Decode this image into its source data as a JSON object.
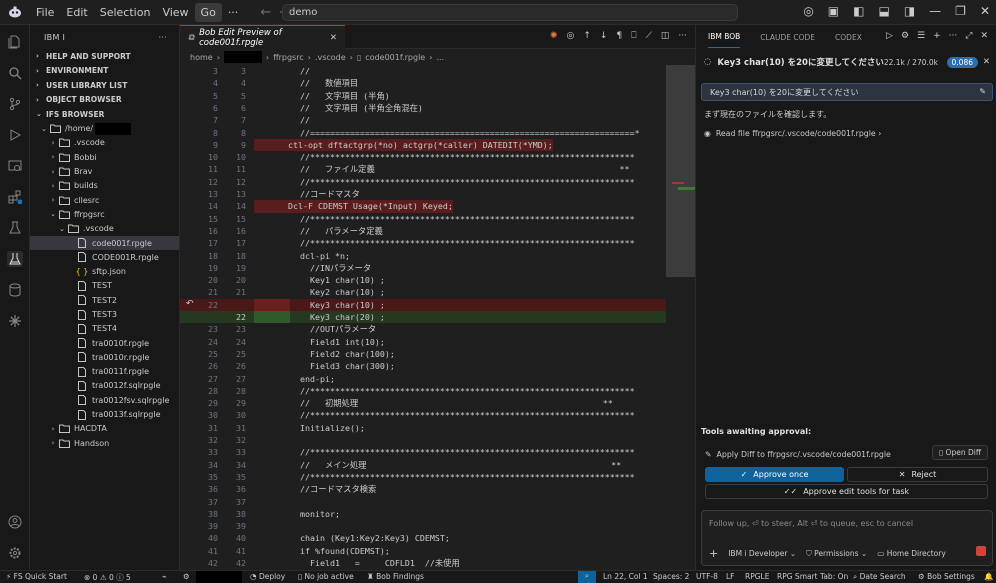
{
  "menu": {
    "items": [
      "File",
      "Edit",
      "Selection",
      "View",
      "Go"
    ],
    "more": "···"
  },
  "search": {
    "value": "demo"
  },
  "activity": {
    "icons": [
      "files-icon",
      "search-icon",
      "source-control-icon",
      "run-debug-icon",
      "remote-explorer-icon",
      "extensions-icon",
      "testing-icon",
      "ibmi-icon",
      "database-icon",
      "bob-icon",
      "account-icon",
      "settings-icon"
    ]
  },
  "sidebar": {
    "title": "IBM I",
    "sections": [
      "HELP AND SUPPORT",
      "ENVIRONMENT",
      "USER LIBRARY LIST",
      "OBJECT BROWSER",
      "IFS BROWSER"
    ],
    "tree": [
      {
        "label": "/home/",
        "indent": 1,
        "twisty": "⌄",
        "icon": "folder-open",
        "redact": true
      },
      {
        "label": ".vscode",
        "indent": 2,
        "twisty": "›",
        "icon": "folder"
      },
      {
        "label": "Bobbi",
        "indent": 2,
        "twisty": "›",
        "icon": "folder"
      },
      {
        "label": "Brav",
        "indent": 2,
        "twisty": "›",
        "icon": "folder"
      },
      {
        "label": "builds",
        "indent": 2,
        "twisty": "›",
        "icon": "folder"
      },
      {
        "label": "cllesrc",
        "indent": 2,
        "twisty": "›",
        "icon": "folder"
      },
      {
        "label": "ffrpgsrc",
        "indent": 2,
        "twisty": "⌄",
        "icon": "folder-open"
      },
      {
        "label": ".vscode",
        "indent": 3,
        "twisty": "⌄",
        "icon": "folder-open"
      },
      {
        "label": "code001f.rpgle",
        "indent": 4,
        "twisty": "",
        "icon": "file",
        "selected": true
      },
      {
        "label": "CODE001R.rpgle",
        "indent": 4,
        "twisty": "",
        "icon": "file"
      },
      {
        "label": "sftp.json",
        "indent": 4,
        "twisty": "",
        "icon": "json"
      },
      {
        "label": "TEST",
        "indent": 4,
        "twisty": "",
        "icon": "file"
      },
      {
        "label": "TEST2",
        "indent": 4,
        "twisty": "",
        "icon": "file"
      },
      {
        "label": "TEST3",
        "indent": 4,
        "twisty": "",
        "icon": "file"
      },
      {
        "label": "TEST4",
        "indent": 4,
        "twisty": "",
        "icon": "file"
      },
      {
        "label": "tra0010f.rpgle",
        "indent": 4,
        "twisty": "",
        "icon": "file"
      },
      {
        "label": "tra0010r.rpgle",
        "indent": 4,
        "twisty": "",
        "icon": "file"
      },
      {
        "label": "tra0011f.rpgle",
        "indent": 4,
        "twisty": "",
        "icon": "file"
      },
      {
        "label": "tra0012f.sqlrpgle",
        "indent": 4,
        "twisty": "",
        "icon": "file"
      },
      {
        "label": "tra0012fsv.sqlrpgle",
        "indent": 4,
        "twisty": "",
        "icon": "file"
      },
      {
        "label": "tra0013f.sqlrpgle",
        "indent": 4,
        "twisty": "",
        "icon": "file"
      },
      {
        "label": "HACDTA",
        "indent": 2,
        "twisty": "›",
        "icon": "folder"
      },
      {
        "label": "Handson",
        "indent": 2,
        "twisty": "›",
        "icon": "folder"
      }
    ]
  },
  "editor": {
    "tab_title": "Bob Edit Preview of code001f.rpgle",
    "breadcrumb": [
      "home",
      "ffrpgsrc",
      ".vscode",
      "code001f.rpgle",
      "..."
    ],
    "lines": [
      {
        "l": "3",
        "r": "3",
        "t": "  //",
        "kind": ""
      },
      {
        "l": "4",
        "r": "4",
        "t": "  //   数値項目",
        "kind": ""
      },
      {
        "l": "5",
        "r": "5",
        "t": "  //   文字項目 (半角)",
        "kind": ""
      },
      {
        "l": "6",
        "r": "6",
        "t": "  //   文字項目 (半角全角混在)",
        "kind": ""
      },
      {
        "l": "7",
        "r": "7",
        "t": "  //",
        "kind": ""
      },
      {
        "l": "8",
        "r": "8",
        "t": "  //=================================================================*",
        "kind": ""
      },
      {
        "l": "9",
        "r": "9",
        "t": "ctl-opt dftactgrp(*no) actgrp(*caller) DATEDIT(*YMD);",
        "kind": "mark"
      },
      {
        "l": "10",
        "r": "10",
        "t": "  //*****************************************************************",
        "kind": ""
      },
      {
        "l": "11",
        "r": "11",
        "t": "  //   ファイル定義                                                 **",
        "kind": ""
      },
      {
        "l": "12",
        "r": "12",
        "t": "  //*****************************************************************",
        "kind": ""
      },
      {
        "l": "13",
        "r": "13",
        "t": "  //コードマスタ",
        "kind": ""
      },
      {
        "l": "14",
        "r": "14",
        "t": "Dcl-F CDEMST Usage(*Input) Keyed;",
        "kind": "mark"
      },
      {
        "l": "15",
        "r": "15",
        "t": "  //*****************************************************************",
        "kind": ""
      },
      {
        "l": "16",
        "r": "16",
        "t": "  //   パラメータ定義",
        "kind": ""
      },
      {
        "l": "17",
        "r": "17",
        "t": "  //*****************************************************************",
        "kind": ""
      },
      {
        "l": "18",
        "r": "18",
        "t": "  dcl-pi *n;",
        "kind": ""
      },
      {
        "l": "19",
        "r": "19",
        "t": "    //INパラメータ",
        "kind": ""
      },
      {
        "l": "20",
        "r": "20",
        "t": "    Key1 char(10) ;",
        "kind": ""
      },
      {
        "l": "21",
        "r": "21",
        "t": "    Key2 char(10) ;",
        "kind": ""
      },
      {
        "l": "22",
        "r": "",
        "t": "    Key3 char(10) ;",
        "kind": "del"
      },
      {
        "l": "",
        "r": "22",
        "t": "    Key3 char(20) ;",
        "kind": "add"
      },
      {
        "l": "23",
        "r": "23",
        "t": "    //OUTパラメータ",
        "kind": ""
      },
      {
        "l": "24",
        "r": "24",
        "t": "    Field1 int(10);",
        "kind": ""
      },
      {
        "l": "25",
        "r": "25",
        "t": "    Field2 char(100);",
        "kind": ""
      },
      {
        "l": "26",
        "r": "26",
        "t": "    Field3 char(300);",
        "kind": ""
      },
      {
        "l": "27",
        "r": "27",
        "t": "  end-pi;",
        "kind": ""
      },
      {
        "l": "28",
        "r": "28",
        "t": "  //*****************************************************************",
        "kind": ""
      },
      {
        "l": "29",
        "r": "29",
        "t": "  //   初期処理                                                 **",
        "kind": ""
      },
      {
        "l": "30",
        "r": "30",
        "t": "  //*****************************************************************",
        "kind": ""
      },
      {
        "l": "31",
        "r": "31",
        "t": "  Initialize();",
        "kind": ""
      },
      {
        "l": "32",
        "r": "32",
        "t": "",
        "kind": ""
      },
      {
        "l": "33",
        "r": "33",
        "t": "  //*****************************************************************",
        "kind": ""
      },
      {
        "l": "34",
        "r": "34",
        "t": "  //   メイン処理                                                 **",
        "kind": ""
      },
      {
        "l": "35",
        "r": "35",
        "t": "  //*****************************************************************",
        "kind": ""
      },
      {
        "l": "36",
        "r": "36",
        "t": "  //コードマスタ検索",
        "kind": ""
      },
      {
        "l": "37",
        "r": "37",
        "t": "",
        "kind": ""
      },
      {
        "l": "38",
        "r": "38",
        "t": "  monitor;",
        "kind": ""
      },
      {
        "l": "39",
        "r": "39",
        "t": "",
        "kind": ""
      },
      {
        "l": "40",
        "r": "40",
        "t": "  chain (Key1:Key2:Key3) CDEMST;",
        "kind": ""
      },
      {
        "l": "41",
        "r": "41",
        "t": "  if %found(CDEMST);",
        "kind": ""
      },
      {
        "l": "42",
        "r": "42",
        "t": "    Field1   =     CDFLD1  //未使用",
        "kind": ""
      }
    ]
  },
  "panel": {
    "tabs": [
      "IBM BOB",
      "CLAUDE CODE",
      "CODEX"
    ],
    "task_title": "Key3 char(10) を20に変更してください",
    "tokens": "22.1k / 270.0k",
    "cost": "0.086",
    "user_message": "Key3 char(10) を20に変更してください",
    "reply": "まず現在のファイルを確認します。",
    "read_file": "Read file ffrpgsrc/.vscode/code001f.rpgle",
    "approval_title": "Tools awaiting approval:",
    "apply_diff": "Apply Diff to ffrpgsrc/.vscode/code001f.rpgle",
    "open_diff": "Open Diff",
    "approve_once": "Approve once",
    "reject": "Reject",
    "approve_edit_tools": "Approve edit tools for task",
    "chat_placeholder": "Follow up, ⏎ to steer, Alt ⏎ to queue, esc to cancel",
    "mode": "IBM i Developer",
    "permissions": "Permissions",
    "home_dir": "Home Directory"
  },
  "status": {
    "quick_start": "FS Quick Start",
    "problems": "0",
    "warnings": "0",
    "infos": "5",
    "deploy": "Deploy",
    "job": "No job active",
    "findings": "Bob Findings",
    "position": "Ln 22, Col 1",
    "spaces": "Spaces: 2",
    "encoding": "UTF-8",
    "eol": "LF",
    "language": "RPGLE",
    "smart_tab": "RPG Smart Tab: On",
    "date_search": "Date Search",
    "bob_settings": "Bob Settings"
  },
  "colors": {
    "accent": "#0078d4",
    "approve": "#0e639c",
    "added_bg": "#24391f",
    "deleted_bg": "#4b1818",
    "mark_bg": "#5a1d1d"
  }
}
